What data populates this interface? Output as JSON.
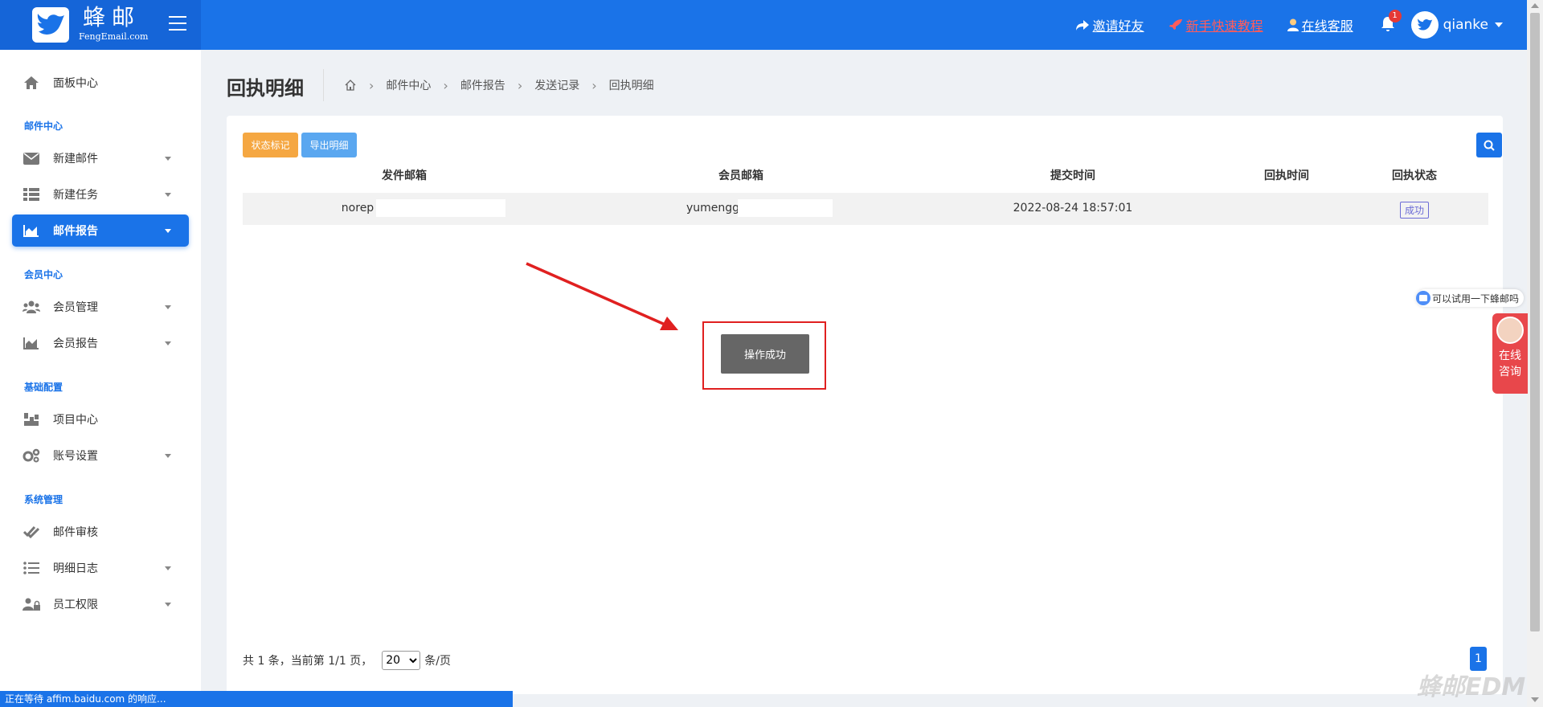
{
  "header": {
    "logo_name": "蜂邮",
    "logo_sub": "FengEmail.com",
    "nav": {
      "invite": "邀请好友",
      "tutorial": "新手快速教程",
      "service": "在线客服"
    },
    "notification_count": "1",
    "username": "qianke"
  },
  "sidebar": {
    "items": [
      {
        "label": "面板中心"
      },
      {
        "label": "新建邮件"
      },
      {
        "label": "新建任务"
      },
      {
        "label": "邮件报告"
      },
      {
        "label": "会员管理"
      },
      {
        "label": "会员报告"
      },
      {
        "label": "项目中心"
      },
      {
        "label": "账号设置"
      },
      {
        "label": "邮件审核"
      },
      {
        "label": "明细日志"
      },
      {
        "label": "员工权限"
      }
    ],
    "sections": [
      "邮件中心",
      "会员中心",
      "基础配置",
      "系统管理"
    ]
  },
  "page": {
    "title": "回执明细",
    "breadcrumb": [
      "邮件中心",
      "邮件报告",
      "发送记录",
      "回执明细"
    ]
  },
  "toolbar": {
    "status_mark": "状态标记",
    "export": "导出明细"
  },
  "table": {
    "columns": [
      "发件邮箱",
      "会员邮箱",
      "提交时间",
      "回执时间",
      "回执状态"
    ],
    "rows": [
      {
        "sender": "norep",
        "member": "yumengg",
        "submit_time": "2022-08-24 18:57:01",
        "receipt_time": "",
        "status": "成功"
      }
    ]
  },
  "toast": {
    "message": "操作成功"
  },
  "pagination": {
    "summary": "共 1 条，当前第 1/1 页，",
    "page_size": "20",
    "unit": "条/页",
    "current_page": "1"
  },
  "float": {
    "bubble_text": "可以试用一下蜂邮吗",
    "service_line1": "在线",
    "service_line2": "咨询"
  },
  "watermark": "蜂邮EDM",
  "statusbar": {
    "text": "正在等待 affim.baidu.com 的响应..."
  },
  "colors": {
    "primary": "#1a73e8",
    "orange": "#f5a742",
    "light_blue": "#5aa7f0",
    "danger": "#e02020"
  }
}
